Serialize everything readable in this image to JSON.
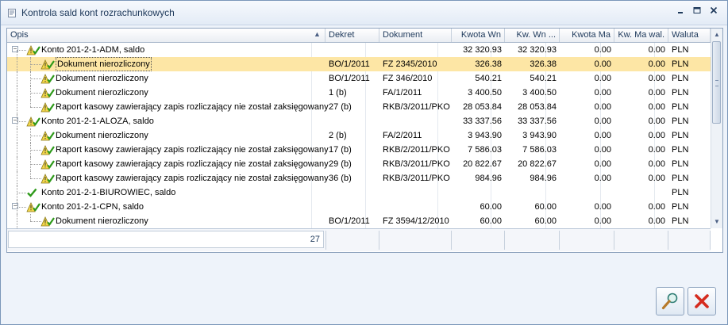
{
  "window": {
    "title": "Kontrola sald kont rozrachunkowych",
    "minimize_icon": "minimize-icon",
    "maximize_icon": "maximize-icon",
    "close_icon": "close-icon"
  },
  "grid": {
    "columns": [
      {
        "label": "Opis"
      },
      {
        "label": "Dekret"
      },
      {
        "label": "Dokument"
      },
      {
        "label": "Kwota Wn"
      },
      {
        "label": "Kw. Wn ..."
      },
      {
        "label": "Kwota Ma"
      },
      {
        "label": "Kw. Ma wal."
      },
      {
        "label": "Waluta"
      }
    ],
    "rows": [
      {
        "level": 0,
        "icon": "warning-icon",
        "opis": "Konto 201-2-1-ADM, saldo",
        "dekret": "",
        "dokument": "",
        "kwota_wn": "32 320.93",
        "kw_wn_wal": "32 320.93",
        "kwota_ma": "0.00",
        "kw_ma_wal": "0.00",
        "waluta": "PLN",
        "selected": false
      },
      {
        "level": 1,
        "icon": "warning-icon",
        "opis": "Dokument nierozliczony",
        "dekret": "BO/1/2011",
        "dokument": "FZ 2345/2010",
        "kwota_wn": "326.38",
        "kw_wn_wal": "326.38",
        "kwota_ma": "0.00",
        "kw_ma_wal": "0.00",
        "waluta": "PLN",
        "selected": true
      },
      {
        "level": 1,
        "icon": "warning-icon",
        "opis": "Dokument nierozliczony",
        "dekret": "BO/1/2011",
        "dokument": "FZ 346/2010",
        "kwota_wn": "540.21",
        "kw_wn_wal": "540.21",
        "kwota_ma": "0.00",
        "kw_ma_wal": "0.00",
        "waluta": "PLN",
        "selected": false
      },
      {
        "level": 1,
        "icon": "warning-icon",
        "opis": "Dokument nierozliczony",
        "dekret": "1 (b)",
        "dokument": "FA/1/2011",
        "kwota_wn": "3 400.50",
        "kw_wn_wal": "3 400.50",
        "kwota_ma": "0.00",
        "kw_ma_wal": "0.00",
        "waluta": "PLN",
        "selected": false
      },
      {
        "level": 1,
        "icon": "warning-icon",
        "opis": "Raport kasowy zawierający zapis rozliczający nie został zaksięgowany",
        "dekret": "27 (b)",
        "dokument": "RKB/3/2011/PKO",
        "kwota_wn": "28 053.84",
        "kw_wn_wal": "28 053.84",
        "kwota_ma": "0.00",
        "kw_ma_wal": "0.00",
        "waluta": "PLN",
        "selected": false
      },
      {
        "level": 0,
        "icon": "warning-icon",
        "opis": "Konto 201-2-1-ALOZA, saldo",
        "dekret": "",
        "dokument": "",
        "kwota_wn": "33 337.56",
        "kw_wn_wal": "33 337.56",
        "kwota_ma": "0.00",
        "kw_ma_wal": "0.00",
        "waluta": "PLN",
        "selected": false
      },
      {
        "level": 1,
        "icon": "warning-icon",
        "opis": "Dokument nierozliczony",
        "dekret": "2 (b)",
        "dokument": "FA/2/2011",
        "kwota_wn": "3 943.90",
        "kw_wn_wal": "3 943.90",
        "kwota_ma": "0.00",
        "kw_ma_wal": "0.00",
        "waluta": "PLN",
        "selected": false
      },
      {
        "level": 1,
        "icon": "warning-icon",
        "opis": "Raport kasowy zawierający zapis rozliczający nie został zaksięgowany",
        "dekret": "17 (b)",
        "dokument": "RKB/2/2011/PKO",
        "kwota_wn": "7 586.03",
        "kw_wn_wal": "7 586.03",
        "kwota_ma": "0.00",
        "kw_ma_wal": "0.00",
        "waluta": "PLN",
        "selected": false
      },
      {
        "level": 1,
        "icon": "warning-icon",
        "opis": "Raport kasowy zawierający zapis rozliczający nie został zaksięgowany",
        "dekret": "29 (b)",
        "dokument": "RKB/3/2011/PKO",
        "kwota_wn": "20 822.67",
        "kw_wn_wal": "20 822.67",
        "kwota_ma": "0.00",
        "kw_ma_wal": "0.00",
        "waluta": "PLN",
        "selected": false
      },
      {
        "level": 1,
        "icon": "warning-icon",
        "opis": "Raport kasowy zawierający zapis rozliczający nie został zaksięgowany",
        "dekret": "36 (b)",
        "dokument": "RKB/3/2011/PKO",
        "kwota_wn": "984.96",
        "kw_wn_wal": "984.96",
        "kwota_ma": "0.00",
        "kw_ma_wal": "0.00",
        "waluta": "PLN",
        "selected": false
      },
      {
        "level": 0,
        "icon": "check-icon",
        "opis": "Konto 201-2-1-BIUROWIEC, saldo",
        "dekret": "",
        "dokument": "",
        "kwota_wn": "",
        "kw_wn_wal": "",
        "kwota_ma": "",
        "kw_ma_wal": "",
        "waluta": "PLN",
        "selected": false
      },
      {
        "level": 0,
        "icon": "warning-icon",
        "opis": "Konto 201-2-1-CPN, saldo",
        "dekret": "",
        "dokument": "",
        "kwota_wn": "60.00",
        "kw_wn_wal": "60.00",
        "kwota_ma": "0.00",
        "kw_ma_wal": "0.00",
        "waluta": "PLN",
        "selected": false
      },
      {
        "level": 1,
        "icon": "warning-icon",
        "opis": "Dokument nierozliczony",
        "dekret": "BO/1/2011",
        "dokument": "FZ 3594/12/2010",
        "kwota_wn": "60.00",
        "kw_wn_wal": "60.00",
        "kwota_ma": "0.00",
        "kw_ma_wal": "0.00",
        "waluta": "PLN",
        "selected": false
      }
    ],
    "footer": {
      "count": "27"
    }
  },
  "buttons": {
    "details_icon": "magnifier-icon",
    "close_icon": "red-x-icon"
  },
  "colors": {
    "selection": "#fde6a5",
    "warning": "#f3d64a",
    "check": "#2e9a1a",
    "close": "#d52b1e"
  }
}
